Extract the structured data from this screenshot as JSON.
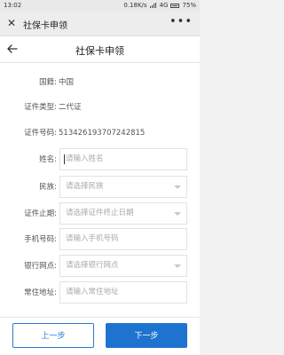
{
  "status_bar": {
    "time": "13:02",
    "speed": "0.18K/s",
    "network": "4G",
    "battery": "75%"
  },
  "miniapp": {
    "title": "社保卡申领",
    "close_icon": "close-icon",
    "more_icon": "more-icon"
  },
  "header": {
    "title": "社保卡申领",
    "back_icon": "back-arrow-icon"
  },
  "info": {
    "nationality_label": "国籍:",
    "nationality_value": "中国",
    "id_type_label": "证件类型:",
    "id_type_value": "二代证",
    "id_number_label": "证件号码:",
    "id_number_value": "513426193707242815"
  },
  "fields": {
    "name": {
      "label": "姓名:",
      "placeholder": "请输入姓名"
    },
    "ethnicity": {
      "label": "民族:",
      "placeholder": "请选择民族"
    },
    "expiry": {
      "label": "证件止期:",
      "placeholder": "请选择证件终止日期"
    },
    "phone": {
      "label": "手机号码:",
      "placeholder": "请输入手机号码"
    },
    "bank": {
      "label": "银行网点:",
      "placeholder": "请选择银行网点"
    },
    "address": {
      "label": "常住地址:",
      "placeholder": "请输入常住地址"
    }
  },
  "buttons": {
    "prev": "上一步",
    "next": "下一步"
  },
  "colors": {
    "accent": "#1f73d0"
  }
}
